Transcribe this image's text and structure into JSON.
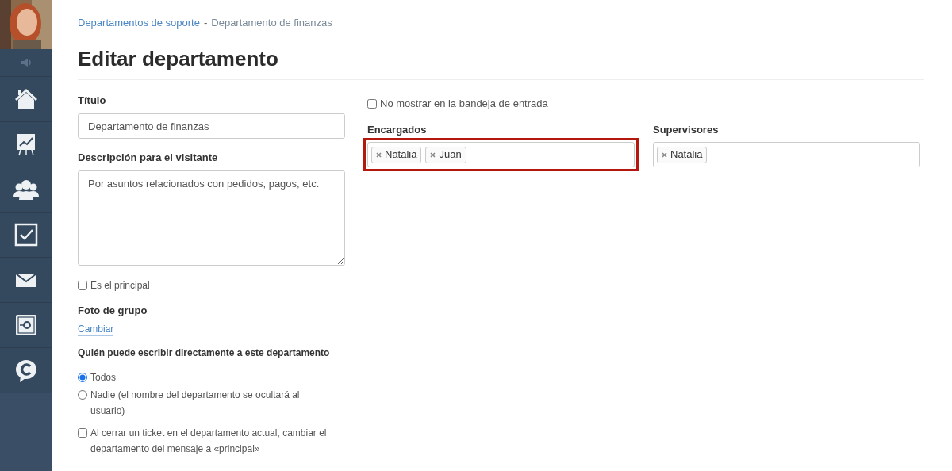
{
  "sidebar": {
    "items": [
      {
        "kind": "home",
        "selected": false
      },
      {
        "kind": "chart",
        "selected": false
      },
      {
        "kind": "people",
        "selected": false
      },
      {
        "kind": "tasks",
        "selected": false
      },
      {
        "kind": "mail",
        "selected": false
      },
      {
        "kind": "safe",
        "selected": false
      },
      {
        "kind": "chat",
        "selected": false
      }
    ]
  },
  "breadcrumb": {
    "items": [
      "Departamentos de soporte",
      "Departamento de finanzas"
    ],
    "separator": "-"
  },
  "title": "Editar departamento",
  "left": {
    "title_label": "Título",
    "title_value": "Departamento de finanzas",
    "description_label": "Descripción para el visitante",
    "description_value": "Por asuntos relacionados con pedidos, pagos, etc.",
    "main_checkbox": {
      "label": "Es el principal",
      "checked": false
    },
    "photo_label": "Foto de grupo",
    "photo_link": "Cambiar",
    "who_label": "Quién puede escribir directamente a este departamento",
    "who_options": [
      {
        "label": "Todos",
        "selected": true
      },
      {
        "label": "Nadie (el nombre del departamento se ocultará al usuario)",
        "selected": false
      }
    ],
    "close_checkbox": {
      "label": "Al cerrar un ticket en el departamento actual, cambiar el departamento del mensaje a «principal»",
      "checked": false
    }
  },
  "right": {
    "inbox_checkbox": {
      "label": "No mostrar en la bandeja de entrada",
      "checked": false
    },
    "fields": [
      {
        "label": "Encargados",
        "tags": [
          "Natalia",
          "Juan"
        ],
        "highlighted": true
      },
      {
        "label": "Supervisores",
        "tags": [
          "Natalia"
        ],
        "highlighted": false
      }
    ]
  }
}
